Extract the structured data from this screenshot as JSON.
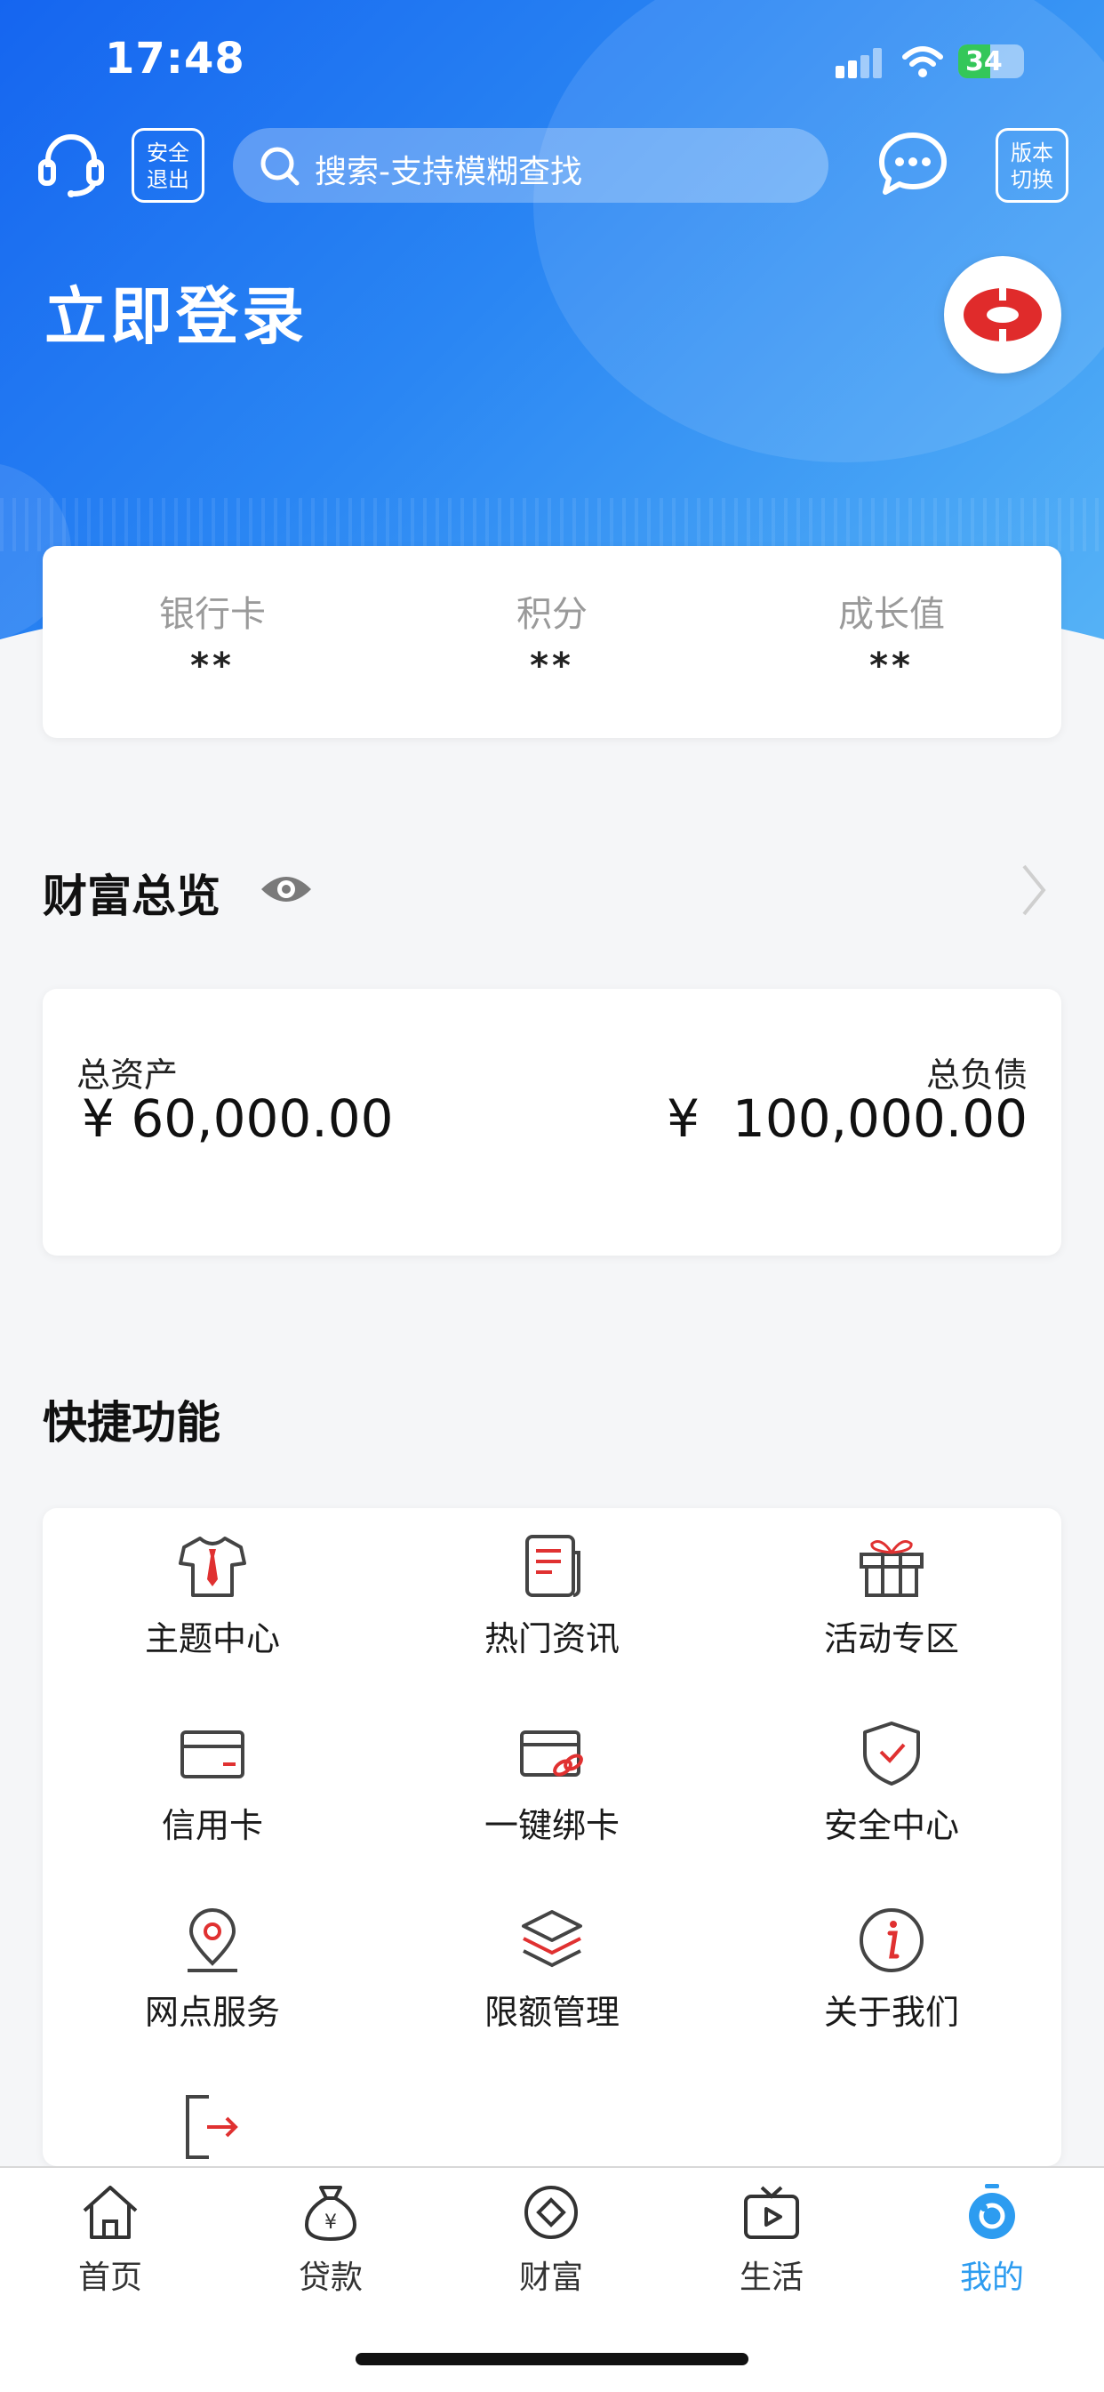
{
  "status_bar": {
    "time": "17:48",
    "battery": "34"
  },
  "header": {
    "logout_label": "安全退出",
    "logout_line1": "安全",
    "logout_line2": "退出",
    "search_placeholder": "搜索-支持模糊查找",
    "version_line1": "版本",
    "version_line2": "切换",
    "login_title": "立即登录"
  },
  "stats": [
    {
      "label": "银行卡",
      "value": "**"
    },
    {
      "label": "积分",
      "value": "**"
    },
    {
      "label": "成长值",
      "value": "**"
    }
  ],
  "wealth": {
    "title": "财富总览",
    "total_assets_label": "总资产",
    "total_assets_value": "¥ 60,000.00",
    "total_liabilities_label": "总负债",
    "total_liabilities_value": "¥  100,000.00"
  },
  "quick": {
    "title": "快捷功能",
    "items": [
      {
        "label": "主题中心",
        "icon": "shirt-icon"
      },
      {
        "label": "热门资讯",
        "icon": "news-icon"
      },
      {
        "label": "活动专区",
        "icon": "gift-icon"
      },
      {
        "label": "信用卡",
        "icon": "credit-card-icon"
      },
      {
        "label": "一键绑卡",
        "icon": "bind-card-icon"
      },
      {
        "label": "安全中心",
        "icon": "shield-check-icon"
      },
      {
        "label": "网点服务",
        "icon": "location-pin-icon"
      },
      {
        "label": "限额管理",
        "icon": "layers-icon"
      },
      {
        "label": "关于我们",
        "icon": "info-icon"
      },
      {
        "label": "",
        "icon": "exit-icon"
      }
    ]
  },
  "tabs": [
    {
      "label": "首页",
      "icon": "home-icon"
    },
    {
      "label": "贷款",
      "icon": "money-bag-icon"
    },
    {
      "label": "财富",
      "icon": "diamond-icon"
    },
    {
      "label": "生活",
      "icon": "tv-icon"
    },
    {
      "label": "我的",
      "icon": "profile-icon",
      "active": true
    }
  ],
  "colors": {
    "primary_blue": "#1565f0",
    "active_tab": "#2d9cf0",
    "accent_red": "#e03131"
  }
}
